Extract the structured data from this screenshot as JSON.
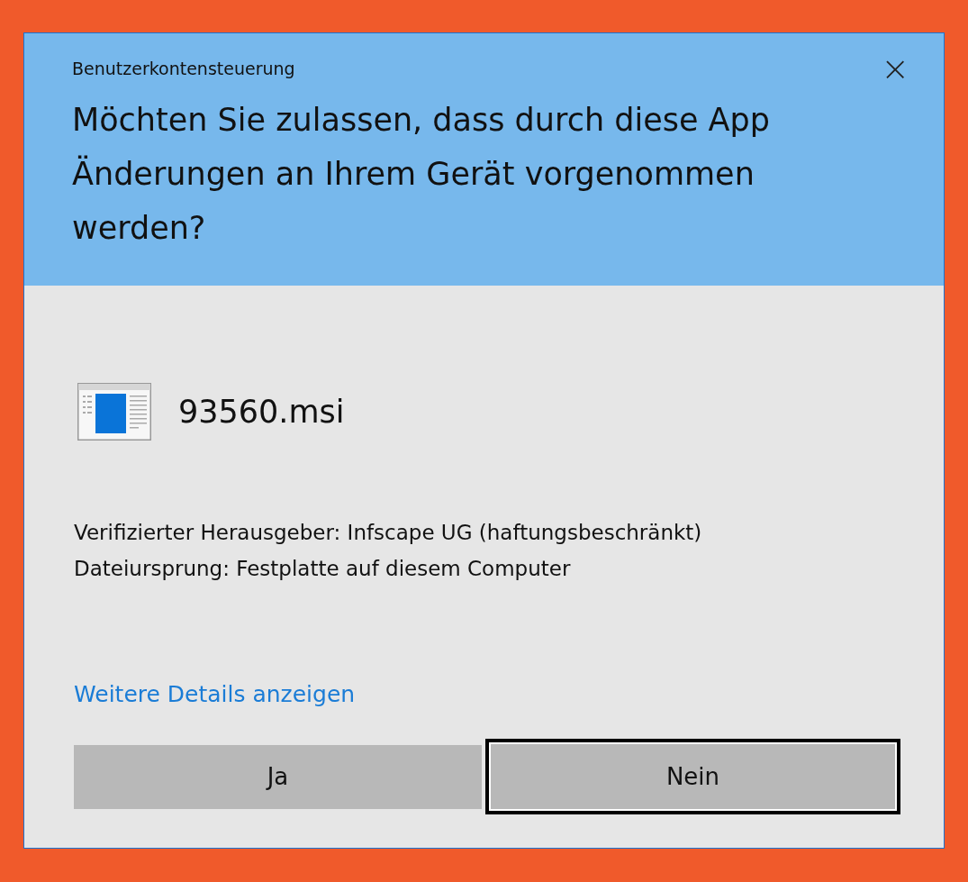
{
  "window": {
    "title": "Benutzerkontensteuerung",
    "close": "×"
  },
  "question": "Möchten Sie zulassen, dass durch diese App Änderungen an Ihrem Gerät vorgenommen werden?",
  "app": {
    "name": "93560.msi"
  },
  "details": [
    "Verifizierter Herausgeber: Infscape UG (haftungsbeschränkt)",
    "Dateiursprung: Festplatte auf diesem Computer"
  ],
  "more_link": "Weitere Details anzeigen",
  "buttons": [
    {
      "label": "Ja",
      "focused": false
    },
    {
      "label": "Nein",
      "focused": true
    }
  ]
}
